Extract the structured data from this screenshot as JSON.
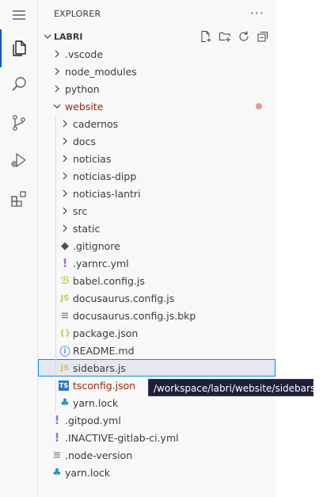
{
  "activity_bar": {
    "items": [
      {
        "icon": "menu-icon"
      },
      {
        "icon": "files-icon"
      },
      {
        "icon": "search-icon"
      },
      {
        "icon": "source-control-icon"
      },
      {
        "icon": "run-debug-icon"
      },
      {
        "icon": "extensions-icon"
      }
    ],
    "accent": "#005fb8"
  },
  "explorer": {
    "title": "EXPLORER",
    "more": "···",
    "section_title": "LABRI",
    "actions": [
      "new-file-icon",
      "new-folder-icon",
      "refresh-icon",
      "collapse-all-icon"
    ]
  },
  "tree": [
    {
      "label": ".vscode",
      "kind": "folder",
      "level": 0,
      "expanded": false
    },
    {
      "label": "node_modules",
      "kind": "folder",
      "level": 0,
      "expanded": false
    },
    {
      "label": "python",
      "kind": "folder",
      "level": 0,
      "expanded": false
    },
    {
      "label": "website",
      "kind": "folder",
      "level": 0,
      "expanded": true,
      "modified": true,
      "color": "#a1260d"
    },
    {
      "label": "cadernos",
      "kind": "folder",
      "level": 1,
      "expanded": false
    },
    {
      "label": "docs",
      "kind": "folder",
      "level": 1,
      "expanded": false
    },
    {
      "label": "noticias",
      "kind": "folder",
      "level": 1,
      "expanded": false
    },
    {
      "label": "noticias-dipp",
      "kind": "folder",
      "level": 1,
      "expanded": false
    },
    {
      "label": "noticias-lantri",
      "kind": "folder",
      "level": 1,
      "expanded": false
    },
    {
      "label": "src",
      "kind": "folder",
      "level": 1,
      "expanded": false
    },
    {
      "label": "static",
      "kind": "folder",
      "level": 1,
      "expanded": false
    },
    {
      "label": ".gitignore",
      "kind": "file",
      "level": 1,
      "icon": "git-icon"
    },
    {
      "label": ".yarnrc.yml",
      "kind": "file",
      "level": 1,
      "icon": "yaml-icon"
    },
    {
      "label": "babel.config.js",
      "kind": "file",
      "level": 1,
      "icon": "babel-icon"
    },
    {
      "label": "docusaurus.config.js",
      "kind": "file",
      "level": 1,
      "icon": "js-icon"
    },
    {
      "label": "docusaurus.config.js.bkp",
      "kind": "file",
      "level": 1,
      "icon": "text-icon"
    },
    {
      "label": "package.json",
      "kind": "file",
      "level": 1,
      "icon": "json-icon"
    },
    {
      "label": "README.md",
      "kind": "file",
      "level": 1,
      "icon": "info-icon"
    },
    {
      "label": "sidebars.js",
      "kind": "file",
      "level": 1,
      "icon": "js-icon",
      "selected": true
    },
    {
      "label": "tsconfig.json",
      "kind": "file",
      "level": 1,
      "icon": "ts-icon",
      "color": "#a1260d"
    },
    {
      "label": "yarn.lock",
      "kind": "file",
      "level": 1,
      "icon": "yarn-icon"
    },
    {
      "label": ".gitpod.yml",
      "kind": "file",
      "level": 0,
      "icon": "yaml-icon"
    },
    {
      "label": ".INACTIVE-gitlab-ci.yml",
      "kind": "file",
      "level": 0,
      "icon": "yaml-icon"
    },
    {
      "label": ".node-version",
      "kind": "file",
      "level": 0,
      "icon": "text-icon"
    },
    {
      "label": "yarn.lock",
      "kind": "file",
      "level": 0,
      "icon": "yarn-icon"
    }
  ],
  "tooltip": {
    "text": "/workspace/labri/website/sidebars.js"
  }
}
